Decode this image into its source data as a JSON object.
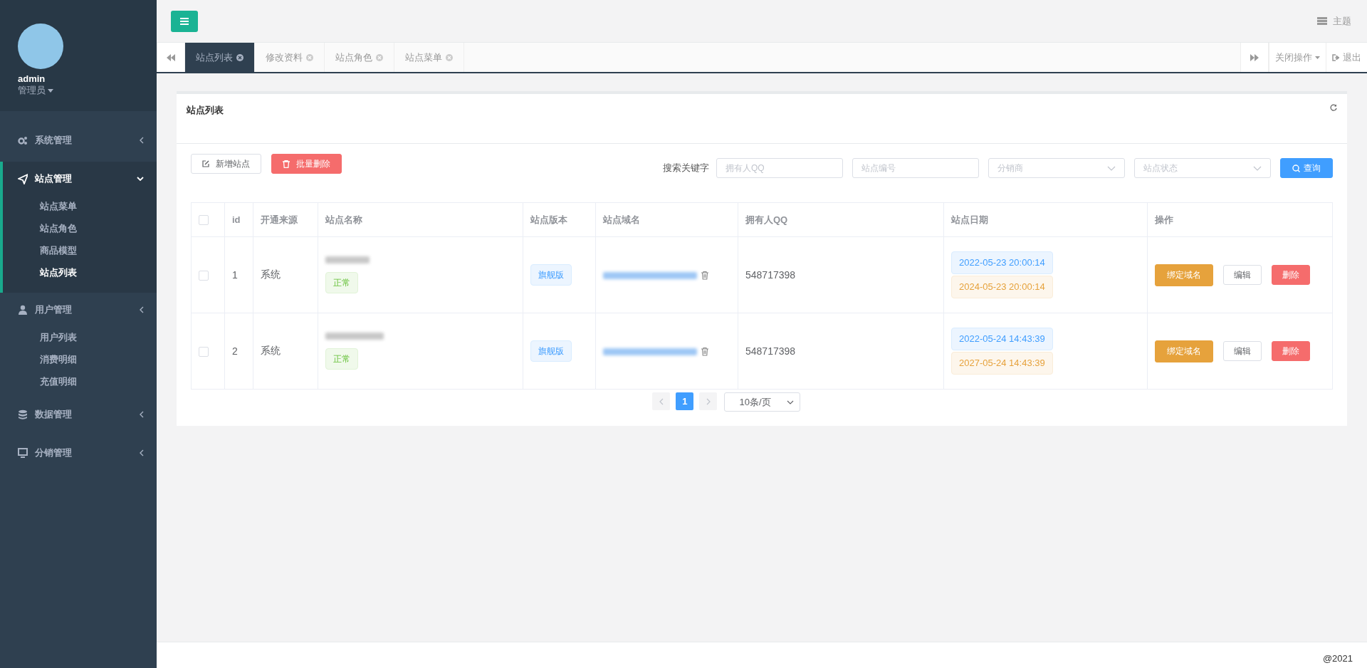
{
  "sidebar": {
    "user": {
      "name": "admin",
      "role": "管理员"
    },
    "menu": [
      {
        "label": "系统管理",
        "expanded": false
      },
      {
        "label": "站点管理",
        "expanded": true,
        "children": [
          {
            "label": "站点菜单",
            "selected": false
          },
          {
            "label": "站点角色",
            "selected": false
          },
          {
            "label": "商品模型",
            "selected": false
          },
          {
            "label": "站点列表",
            "selected": true
          }
        ]
      },
      {
        "label": "用户管理",
        "expanded": false,
        "children": [
          {
            "label": "用户列表",
            "selected": false
          },
          {
            "label": "消费明细",
            "selected": false
          },
          {
            "label": "充值明细",
            "selected": false
          }
        ]
      },
      {
        "label": "数据管理",
        "expanded": false
      },
      {
        "label": "分销管理",
        "expanded": false
      }
    ]
  },
  "topbar": {
    "theme": "主题"
  },
  "tabs": [
    {
      "label": "站点列表",
      "selected": true
    },
    {
      "label": "修改资料",
      "selected": false
    },
    {
      "label": "站点角色",
      "selected": false
    },
    {
      "label": "站点菜单",
      "selected": false
    }
  ],
  "tab_actions": {
    "close_ops": "关闭操作",
    "logout": "退出"
  },
  "panel": {
    "title": "站点列表",
    "buttons": [
      {
        "label": "新增站点",
        "kind": "default"
      },
      {
        "label": "批量删除",
        "kind": "danger"
      }
    ],
    "search": {
      "label": "搜索关键字",
      "fields": [
        {
          "placeholder": "拥有人QQ",
          "kind": "input"
        },
        {
          "placeholder": "站点编号",
          "kind": "input"
        },
        {
          "placeholder": "分销商",
          "kind": "select"
        },
        {
          "placeholder": "站点状态",
          "kind": "select"
        }
      ],
      "button": "查询"
    },
    "table": {
      "header_checked": false,
      "columns": [
        "id",
        "开通来源",
        "站点名称",
        "站点版本",
        "站点域名",
        "拥有人QQ",
        "站点日期",
        "操作"
      ],
      "rows": [
        {
          "checked": false,
          "id": "1",
          "source": "系统",
          "status": "正常",
          "version": "旗舰版",
          "qq": "548717398",
          "start": "2022-05-23 20:00:14",
          "end": "2024-05-23 20:00:14",
          "actions": [
            "绑定域名",
            "编辑",
            "删除"
          ]
        },
        {
          "checked": false,
          "id": "2",
          "source": "系统",
          "status": "正常",
          "version": "旗舰版",
          "qq": "548717398",
          "start": "2022-05-24 14:43:39",
          "end": "2027-05-24 14:43:39",
          "actions": [
            "绑定域名",
            "编辑",
            "删除"
          ]
        }
      ]
    },
    "pagination": {
      "pages": [
        {
          "label": "1",
          "selected": true
        }
      ],
      "page_size": "10条/页"
    }
  },
  "footer": {
    "text": "@2021"
  }
}
